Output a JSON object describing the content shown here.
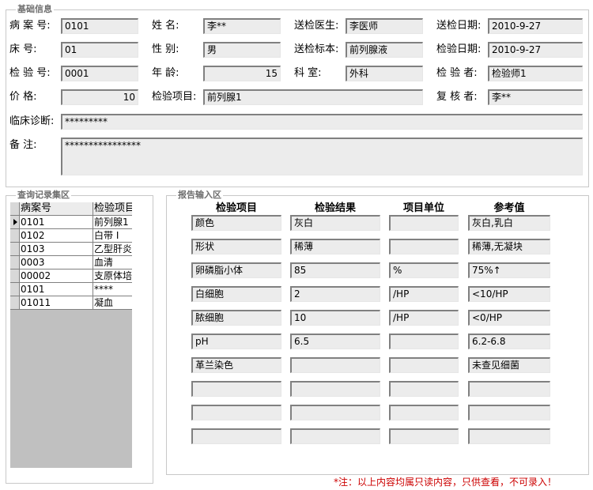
{
  "basic_info": {
    "title": "基础信息",
    "fields": [
      {
        "label": "病 案 号:",
        "value": "0101"
      },
      {
        "label": "姓    名:",
        "value": "李**"
      },
      {
        "label": "送检医生:",
        "value": "李医师"
      },
      {
        "label": "送检日期:",
        "value": "2010-9-27"
      },
      {
        "label": "床    号:",
        "value": "01"
      },
      {
        "label": "性    别:",
        "value": "男"
      },
      {
        "label": "送检标本:",
        "value": "前列腺液"
      },
      {
        "label": "检验日期:",
        "value": "2010-9-27"
      },
      {
        "label": "检 验 号:",
        "value": "0001"
      },
      {
        "label": "年    龄:",
        "value": "15"
      },
      {
        "label": "科    室:",
        "value": "外科"
      },
      {
        "label": "检 验 者:",
        "value": "检验师1"
      },
      {
        "label": "价    格:",
        "value": "10"
      },
      {
        "label": "检验项目:",
        "value": "前列腺1"
      },
      {
        "label": "复 核 者:",
        "value": "李**"
      },
      {
        "label": "临床诊断:",
        "value": "*********"
      },
      {
        "label": "备    注:",
        "value": "****************"
      }
    ]
  },
  "records": {
    "title": "查询记录集区",
    "headers": [
      "病案号",
      "检验项目"
    ],
    "rows": [
      [
        "0101",
        "前列腺1"
      ],
      [
        "0102",
        "白带 I"
      ],
      [
        "0103",
        "乙型肝炎标志"
      ],
      [
        "0003",
        "血清"
      ],
      [
        "00002",
        "支原体培养"
      ],
      [
        "0101",
        "****"
      ],
      [
        "01011",
        "凝血"
      ]
    ]
  },
  "report": {
    "title": "报告输入区",
    "headers": [
      "检验项目",
      "检验结果",
      "项目单位",
      "参考值"
    ],
    "rows": [
      [
        "颜色",
        "灰白",
        "",
        "灰白,乳白"
      ],
      [
        "形状",
        "稀薄",
        "",
        "稀薄,无凝块"
      ],
      [
        "卵磷脂小体",
        "85",
        "%",
        "75%↑"
      ],
      [
        "白细胞",
        "2",
        "/HP",
        "<10/HP"
      ],
      [
        "脓细胞",
        "10",
        "/HP",
        "<0/HP"
      ],
      [
        "pH",
        "6.5",
        "",
        "6.2-6.8"
      ],
      [
        "革兰染色",
        "",
        "",
        "未查见细菌"
      ],
      [
        "",
        "",
        "",
        ""
      ],
      [
        "",
        "",
        "",
        ""
      ],
      [
        "",
        "",
        "",
        ""
      ]
    ]
  },
  "footer_note": "*注：以上内容均属只读内容，只供查看，不可录入！"
}
